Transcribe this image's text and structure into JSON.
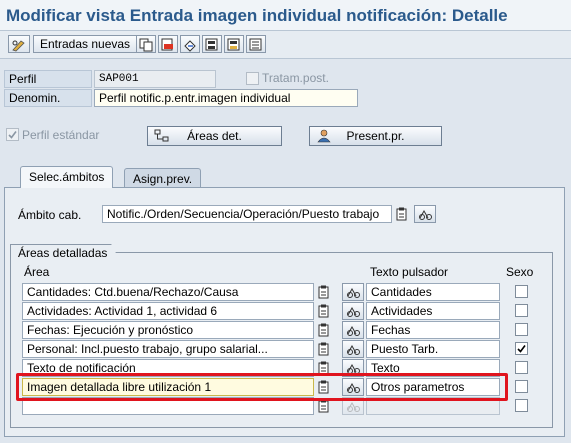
{
  "title": "Modificar vista Entrada imagen individual notificación: Detalle",
  "toolbar": {
    "new_entries_label": "Entradas nuevas",
    "icons": [
      "pencil-glasses-icon",
      "copy-icon",
      "delete-icon",
      "undo-icon",
      "export-icon",
      "import-icon",
      "select-all-icon"
    ]
  },
  "form": {
    "perfil_label": "Perfil",
    "perfil_value": "SAP001",
    "tratam_label": "Tratam.post.",
    "denomin_label": "Denomin.",
    "denomin_value": "Perfil notific.p.entr.imagen individual",
    "perfil_estandar_label": "Perfil estándar",
    "areas_det_label": "Áreas det.",
    "present_label": "Present.pr."
  },
  "tabs": [
    {
      "label": "Selec.ámbitos",
      "active": true
    },
    {
      "label": "Asign.prev.",
      "active": false
    }
  ],
  "ambito": {
    "label": "Ámbito cab.",
    "value": "Notific./Orden/Secuencia/Operación/Puesto trabajo"
  },
  "areas": {
    "group_label": "Áreas detalladas",
    "col_area": "Área",
    "col_texto": "Texto pulsador",
    "col_sexo": "Sexo",
    "rows": [
      {
        "area": "Cantidades: Ctd.buena/Rechazo/Causa",
        "texto": "Cantidades",
        "checked": false
      },
      {
        "area": "Actividades: Actividad 1, actividad 6",
        "texto": "Actividades",
        "checked": false
      },
      {
        "area": "Fechas: Ejecución y pronóstico",
        "texto": "Fechas",
        "checked": false
      },
      {
        "area": "Personal: Incl.puesto trabajo, grupo salarial...",
        "texto": "Puesto Tarb.",
        "checked": true
      },
      {
        "area": "Texto de notificación",
        "texto": "Texto",
        "checked": false
      },
      {
        "area": "Imagen detallada libre utilización 1",
        "texto": "Otros parametros",
        "checked": false
      },
      {
        "area": "",
        "texto": "",
        "checked": false
      }
    ]
  },
  "colors": {
    "highlight": "#e0141e",
    "title": "#2b5a8c"
  }
}
